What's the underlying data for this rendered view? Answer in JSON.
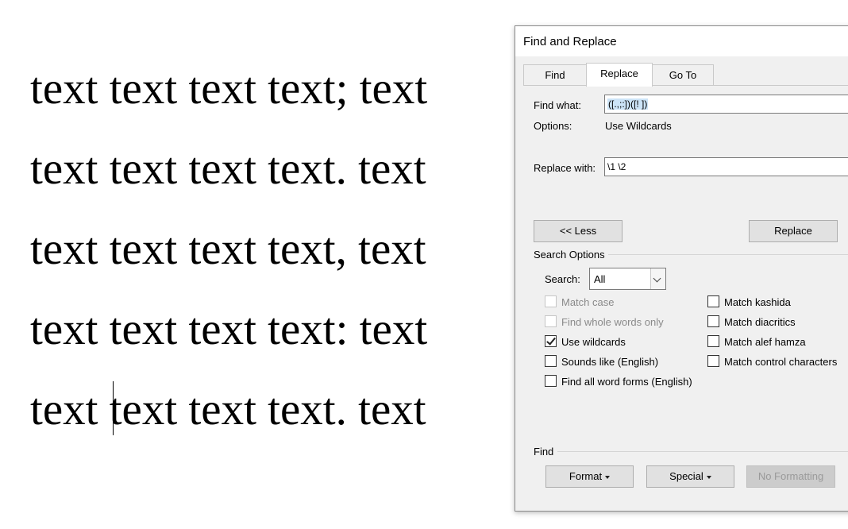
{
  "document": {
    "lines": [
      "text text text text; text",
      "text text text text. text",
      "text text text text, text",
      "text text text text: text",
      "text text text text. text"
    ]
  },
  "dialog": {
    "title": "Find and Replace",
    "tabs": [
      {
        "label": "Find",
        "active": false
      },
      {
        "label": "Replace",
        "active": true
      },
      {
        "label": "Go To",
        "active": false
      }
    ],
    "find_what_label": "Find what:",
    "find_what_value": "([.,;:])([! ])",
    "options_label": "Options:",
    "options_value": "Use Wildcards",
    "replace_with_label": "Replace with:",
    "replace_with_value": "\\1 \\2",
    "less_button": "<< Less",
    "replace_button": "Replace",
    "search_options_heading": "Search Options",
    "search_label": "Search:",
    "search_value": "All",
    "checkboxes_left": [
      {
        "label": "Match case",
        "checked": false,
        "disabled": true
      },
      {
        "label": "Find whole words only",
        "checked": false,
        "disabled": true
      },
      {
        "label": "Use wildcards",
        "checked": true,
        "disabled": false
      },
      {
        "label": "Sounds like (English)",
        "checked": false,
        "disabled": false
      },
      {
        "label": "Find all word forms (English)",
        "checked": false,
        "disabled": false
      }
    ],
    "checkboxes_right": [
      {
        "label": "Match kashida",
        "checked": false,
        "disabled": false
      },
      {
        "label": "Match diacritics",
        "checked": false,
        "disabled": false
      },
      {
        "label": "Match alef hamza",
        "checked": false,
        "disabled": false
      },
      {
        "label": "Match control characters",
        "checked": false,
        "disabled": false
      }
    ],
    "find_section_label": "Find",
    "format_button": "Format",
    "special_button": "Special",
    "no_formatting_button": "No Formatting"
  }
}
